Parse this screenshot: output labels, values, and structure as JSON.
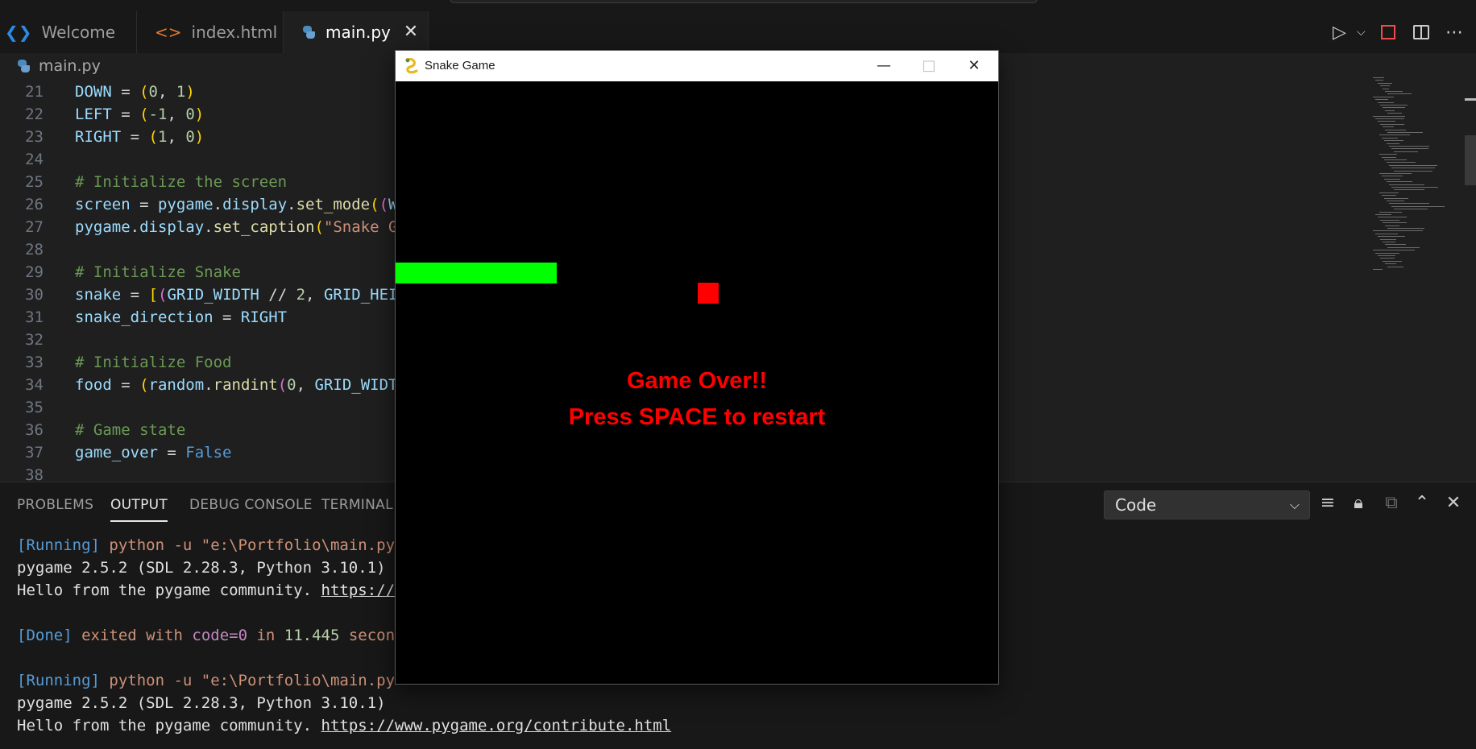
{
  "tabs": [
    {
      "label": "Welcome",
      "icon": "vscode-icon"
    },
    {
      "label": "index.html",
      "icon": "html-icon"
    },
    {
      "label": "main.py",
      "icon": "python-icon",
      "active": true
    }
  ],
  "breadcrumb": {
    "file": "main.py"
  },
  "editor": {
    "lines": [
      {
        "n": "21",
        "code": "DOWN = (0, 1)"
      },
      {
        "n": "22",
        "code": "LEFT = (-1, 0)"
      },
      {
        "n": "23",
        "code": "RIGHT = (1, 0)"
      },
      {
        "n": "24",
        "code": ""
      },
      {
        "n": "25",
        "code": "# Initialize the screen"
      },
      {
        "n": "26",
        "code": "screen = pygame.display.set_mode((W"
      },
      {
        "n": "27",
        "code": "pygame.display.set_caption(\"Snake G"
      },
      {
        "n": "28",
        "code": ""
      },
      {
        "n": "29",
        "code": "# Initialize Snake"
      },
      {
        "n": "30",
        "code": "snake = [(GRID_WIDTH // 2, GRID_HEI"
      },
      {
        "n": "31",
        "code": "snake_direction = RIGHT"
      },
      {
        "n": "32",
        "code": ""
      },
      {
        "n": "33",
        "code": "# Initialize Food"
      },
      {
        "n": "34",
        "code": "food = (random.randint(0, GRID_WIDT"
      },
      {
        "n": "35",
        "code": ""
      },
      {
        "n": "36",
        "code": "# Game state"
      },
      {
        "n": "37",
        "code": "game_over = False"
      },
      {
        "n": "38",
        "code": ""
      }
    ]
  },
  "panel": {
    "tabs": [
      "PROBLEMS",
      "OUTPUT",
      "DEBUG CONSOLE",
      "TERMINAL"
    ],
    "active_tab": "OUTPUT",
    "output_channel": "Code",
    "output": [
      {
        "tag": "[Running]",
        "rest": "python -u \"e:\\Portfolio\\main.py"
      },
      {
        "plain": "pygame 2.5.2 (SDL 2.28.3, Python 3.10.1)"
      },
      {
        "plain": "Hello from the pygame community. ",
        "link": "https://"
      },
      {
        "plain": ""
      },
      {
        "tag": "[Done]",
        "exited": "exited with ",
        "code": "code=0",
        "in": " in ",
        "secs": "11.445",
        "secword": " secon"
      },
      {
        "plain": ""
      },
      {
        "tag": "[Running]",
        "rest": "python -u \"e:\\Portfolio\\main.py"
      },
      {
        "plain": "pygame 2.5.2 (SDL 2.28.3, Python 3.10.1)"
      },
      {
        "plain": "Hello from the pygame community. ",
        "link": "https://www.pygame.org/contribute.html"
      }
    ]
  },
  "game_window": {
    "title": "Snake Game",
    "game_over_text": "Game Over!!",
    "restart_text": "Press SPACE to restart",
    "snake_color": "#00ff00",
    "food_color": "#ff0000",
    "text_color": "#ff0000"
  }
}
